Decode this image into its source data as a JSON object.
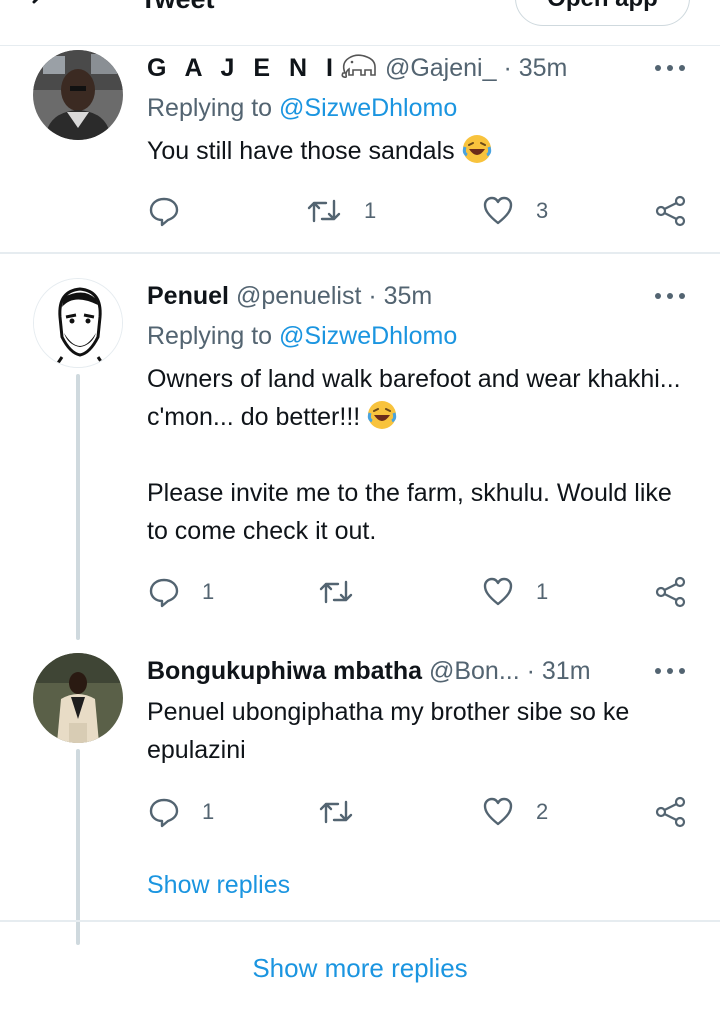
{
  "header": {
    "title": "Tweet",
    "open_app_label": "Open app"
  },
  "tweets": [
    {
      "name": "G A J E N I",
      "handle": "@Gajeni_",
      "separator": "·",
      "time": "35m",
      "replying_prefix": "Replying to",
      "replying_to": "@SizweDhlomo",
      "paragraphs": [
        "You still have those sandals"
      ],
      "reply_count": "",
      "retweet_count": "1",
      "like_count": "3"
    },
    {
      "name": "Penuel",
      "handle": "@penuelist",
      "separator": "·",
      "time": "35m",
      "replying_prefix": "Replying to",
      "replying_to": "@SizweDhlomo",
      "paragraphs": [
        "Owners of land walk barefoot and wear khakhi... c'mon... do better!!!",
        "Please invite me to the farm, skhulu. Would like to come check it out."
      ],
      "reply_count": "1",
      "retweet_count": "",
      "like_count": "1"
    },
    {
      "name": "Bongukuphiwa mbatha",
      "handle": "@Bon...",
      "separator": "·",
      "time": "31m",
      "paragraphs": [
        "Penuel ubongiphatha my brother sibe so ke epulazini"
      ],
      "reply_count": "1",
      "retweet_count": "",
      "like_count": "2"
    }
  ],
  "show_replies_label": "Show replies",
  "show_more_replies_label": "Show more replies",
  "colors": {
    "link": "#1b95e0",
    "secondary_text": "#536471",
    "divider": "#e6ecf0",
    "thread_line": "#cfd9de"
  },
  "icons": [
    "back-arrow-icon",
    "elephant-emoji-icon",
    "more-icon",
    "reply-icon",
    "retweet-icon",
    "like-icon",
    "share-icon",
    "laughing-emoji-icon"
  ]
}
